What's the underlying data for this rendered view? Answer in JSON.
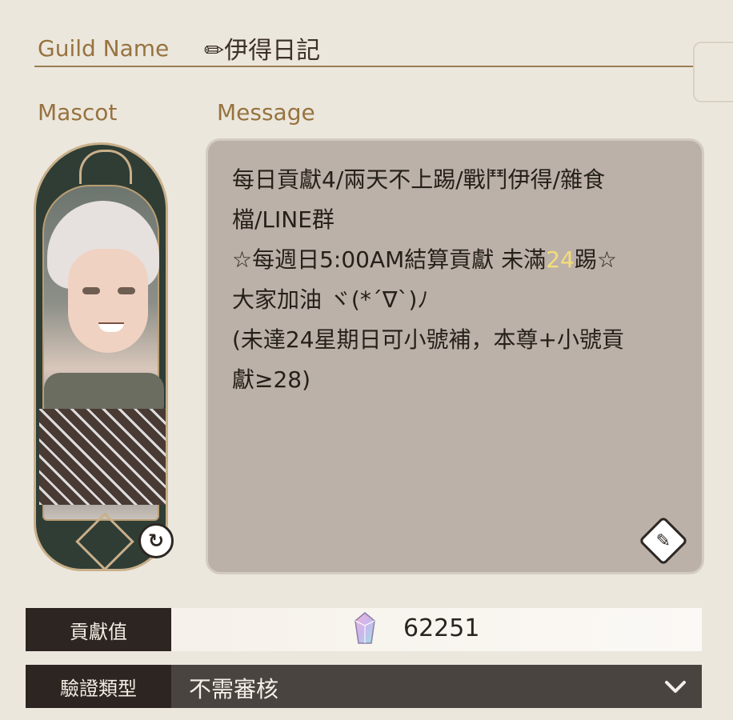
{
  "guild": {
    "name_label": "Guild Name",
    "name_value": "✏伊得日記"
  },
  "mascot": {
    "label": "Mascot",
    "refresh_icon": "↻"
  },
  "message": {
    "label": "Message",
    "lines": [
      "每日貢獻4/兩天不上踢/戰鬥伊得/雜食",
      "檔/LINE群",
      "☆每週日5:00AM結算貢獻 未滿",
      "24",
      "踢☆",
      "大家加油 ヾ(*´∇`)ﾉ",
      "(未達24星期日可小號補，本尊+小號貢",
      "獻≥28)"
    ],
    "highlight_color": "#f5de7a",
    "edit_icon": "✎"
  },
  "contribution": {
    "label": "貢獻值",
    "value": "62251"
  },
  "verification": {
    "label": "驗證類型",
    "value": "不需審核",
    "chevron": "⌄"
  }
}
